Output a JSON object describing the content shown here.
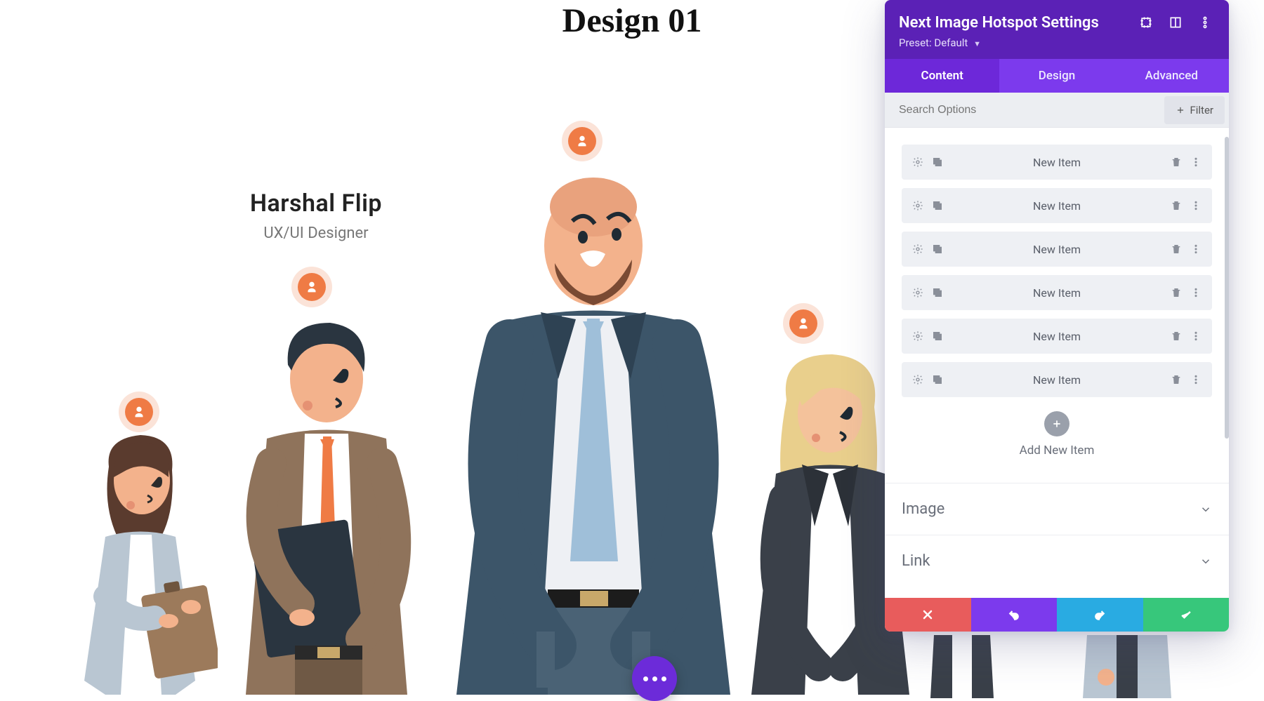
{
  "page": {
    "title": "Design 01"
  },
  "tooltip": {
    "name": "Harshal Flip",
    "role": "UX/UI Designer"
  },
  "panel": {
    "title": "Next Image Hotspot Settings",
    "preset_label": "Preset:",
    "preset_value": "Default",
    "tabs": {
      "content": "Content",
      "design": "Design",
      "advanced": "Advanced"
    },
    "search_placeholder": "Search Options",
    "filter_label": "Filter",
    "items": [
      {
        "label": "New Item"
      },
      {
        "label": "New Item"
      },
      {
        "label": "New Item"
      },
      {
        "label": "New Item"
      },
      {
        "label": "New Item"
      },
      {
        "label": "New Item"
      }
    ],
    "add_label": "Add New Item",
    "sections": {
      "image": "Image",
      "link": "Link"
    }
  }
}
